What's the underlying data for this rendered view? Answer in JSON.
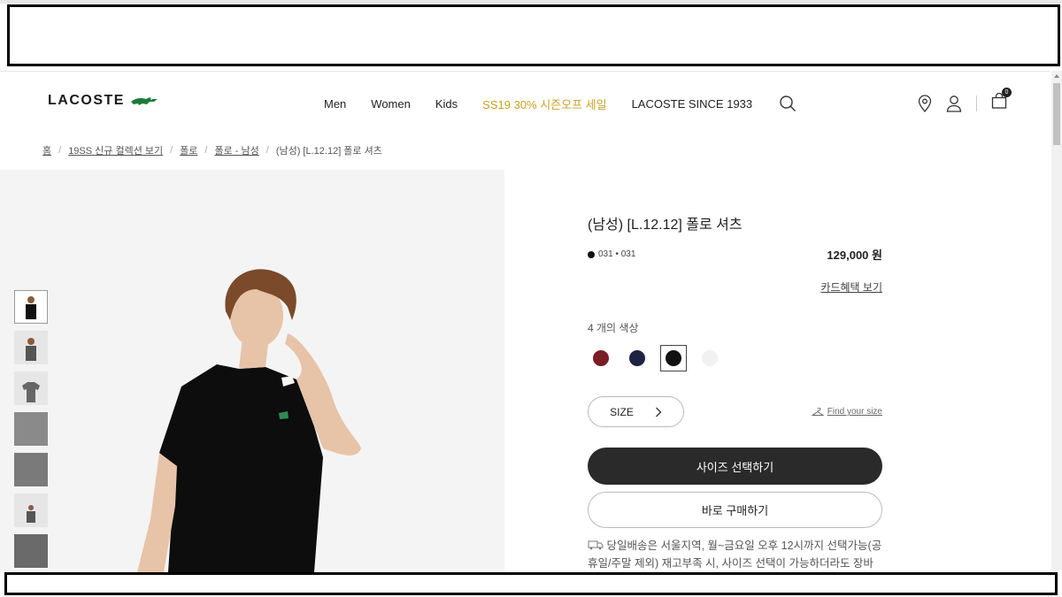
{
  "header": {
    "logo_text": "LACOSTE",
    "nav": [
      {
        "label": "Men"
      },
      {
        "label": "Women"
      },
      {
        "label": "Kids"
      },
      {
        "label": "SS19 30% 시즌오프 세일"
      },
      {
        "label": "LACOSTE SINCE 1933"
      }
    ],
    "cart_count": "0"
  },
  "breadcrumb": {
    "items": [
      "홈",
      "19SS 신규 컬렉션 보기",
      "폴로",
      "폴로 - 남성"
    ],
    "current": "(남성) [L.12.12] 폴로 셔츠"
  },
  "product": {
    "title": "(남성) [L.12.12] 폴로 셔츠",
    "color_code": "031 • 031",
    "price": "129,000 원",
    "card_link": "카드혜택 보기",
    "colors_label": "4 개의 색상",
    "colors": [
      "#7a1e25",
      "#1d2340",
      "#111111",
      "#f1f1f1"
    ],
    "size_label": "SIZE",
    "find_size": "Find your size",
    "primary_btn": "사이즈 선택하기",
    "secondary_btn": "바로 구매하기",
    "delivery_text": "당일배송은 서울지역, 월~금요일 오후 12시까지 선택가능(공휴일/주말 제외) 재고부족 시, 사이즈 선택이 가능하더라도 장바구니에 제품을 담을 수 없습니다."
  },
  "colors": {
    "accent_sale": "#c9a227",
    "brand_green": "#1e7a3c",
    "primary_button": "#2a2a2a"
  }
}
